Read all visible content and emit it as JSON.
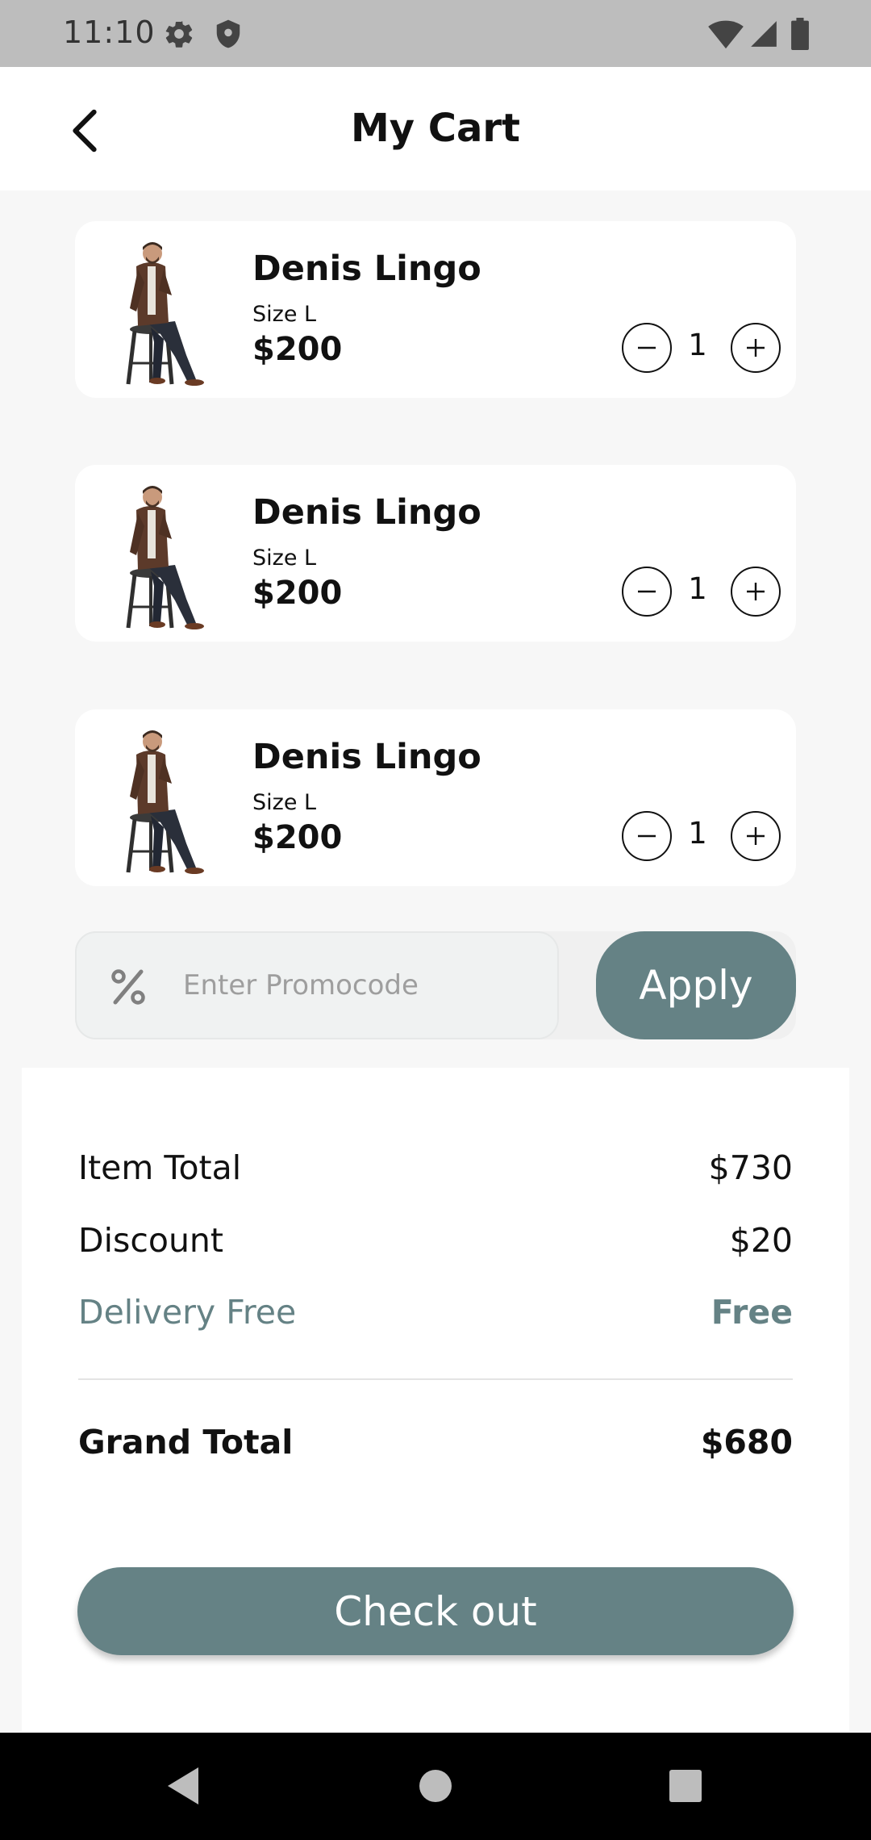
{
  "status_bar": {
    "time": "11:10",
    "icons": [
      "settings-icon",
      "shield-icon",
      "wifi-icon",
      "signal-icon",
      "battery-icon"
    ]
  },
  "header": {
    "title": "My Cart",
    "back_icon": "chevron-left-icon"
  },
  "cart": {
    "items": [
      {
        "name": "Denis Lingo",
        "size": "Size L",
        "price": "$200",
        "quantity": "1"
      },
      {
        "name": "Denis Lingo",
        "size": "Size L",
        "price": "$200",
        "quantity": "1"
      },
      {
        "name": "Denis Lingo",
        "size": "Size L",
        "price": "$200",
        "quantity": "1"
      }
    ]
  },
  "promo": {
    "placeholder": "Enter Promocode",
    "icon": "percent-icon",
    "apply_label": "Apply"
  },
  "summary": {
    "item_total_label": "Item Total",
    "item_total_value": "$730",
    "discount_label": "Discount",
    "discount_value": "$20",
    "delivery_label": "Delivery Free",
    "delivery_value": "Free",
    "grand_total_label": "Grand Total",
    "grand_total_value": "$680",
    "checkout_label": "Check out"
  },
  "colors": {
    "accent": "#658285",
    "status_bar": "#bdbdbd",
    "background": "#f7f7f7"
  },
  "nav_bar": {
    "icons": [
      "back-triangle-icon",
      "home-circle-icon",
      "recents-square-icon"
    ]
  }
}
